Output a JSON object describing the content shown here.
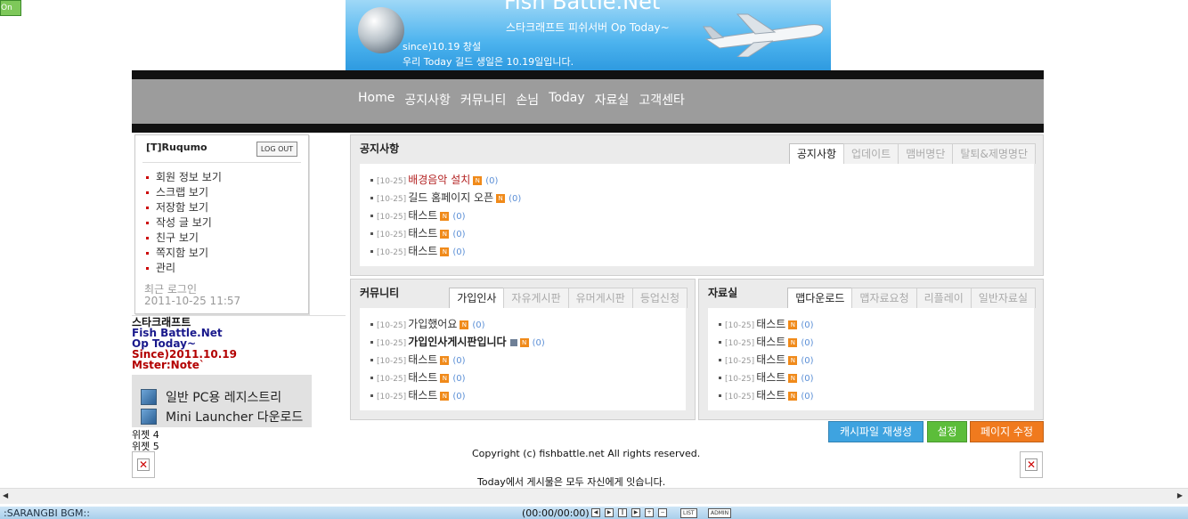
{
  "toggle": {
    "label": "On"
  },
  "banner": {
    "title": "Fish Battle.Net",
    "subtitle": "스타크래프트 피쉬서버 Op Today~",
    "line1": "since)10.19 창설",
    "line2": "우리 Today 길드 생일은 10.19일입니다."
  },
  "nav": {
    "items": [
      "Home",
      "공지사항",
      "커뮤니티",
      "손님",
      "Today",
      "자료실",
      "고객센타"
    ]
  },
  "login": {
    "user": "[T]Ruqumo",
    "logout": "LOG OUT",
    "menu": [
      "회원 정보 보기",
      "스크랩 보기",
      "저장함 보기",
      "작성 글 보기",
      "친구 보기",
      "쪽지함 보기",
      "관리"
    ],
    "last_login_label": "최근 로그인",
    "last_login_value": "2011-10-25 11:57"
  },
  "side": {
    "lines": [
      "스타크래프트",
      "Fish Battle.Net",
      "Op Today~",
      "Since)2011.10.19",
      "Mster:Note`"
    ],
    "pc_registry": "일반 PC용 레지스트리",
    "launcher": "Mini Launcher 다운로드",
    "widget4": "위젯 4",
    "widget5": "위젯 5"
  },
  "notice": {
    "title": "공지사항",
    "tabs": [
      "공지사항",
      "업데이트",
      "맴버명단",
      "탈퇴&제명명단"
    ],
    "items": [
      {
        "date": "[10-25]",
        "title": "배경음악 설치",
        "count": "(0)",
        "style": "red"
      },
      {
        "date": "[10-25]",
        "title": "길드 홈페이지 오픈",
        "count": "(0)",
        "style": ""
      },
      {
        "date": "[10-25]",
        "title": "태스트",
        "count": "(0)",
        "style": ""
      },
      {
        "date": "[10-25]",
        "title": "태스트",
        "count": "(0)",
        "style": ""
      },
      {
        "date": "[10-25]",
        "title": "태스트",
        "count": "(0)",
        "style": ""
      }
    ]
  },
  "community": {
    "title": "커뮤니티",
    "tabs": [
      "가입인사",
      "자유게시판",
      "유머게시판",
      "등업신청"
    ],
    "items": [
      {
        "date": "[10-25]",
        "title": "가입했어요",
        "count": "(0)",
        "style": ""
      },
      {
        "date": "[10-25]",
        "title": "가입인사게시판입니다",
        "count": "(0)",
        "style": "bold",
        "lock": true
      },
      {
        "date": "[10-25]",
        "title": "태스트",
        "count": "(0)",
        "style": ""
      },
      {
        "date": "[10-25]",
        "title": "태스트",
        "count": "(0)",
        "style": ""
      },
      {
        "date": "[10-25]",
        "title": "태스트",
        "count": "(0)",
        "style": ""
      }
    ]
  },
  "archive": {
    "title": "자료실",
    "tabs": [
      "맵다운로드",
      "맵자료요청",
      "리플레이",
      "일반자료실"
    ],
    "items": [
      {
        "date": "[10-25]",
        "title": "태스트",
        "count": "(0)",
        "style": ""
      },
      {
        "date": "[10-25]",
        "title": "태스트",
        "count": "(0)",
        "style": ""
      },
      {
        "date": "[10-25]",
        "title": "태스트",
        "count": "(0)",
        "style": ""
      },
      {
        "date": "[10-25]",
        "title": "태스트",
        "count": "(0)",
        "style": ""
      },
      {
        "date": "[10-25]",
        "title": "태스트",
        "count": "(0)",
        "style": ""
      }
    ]
  },
  "new_badge": "N",
  "buttons": {
    "cache": "캐시파일 재생성",
    "settings": "설정",
    "edit": "페이지 수정"
  },
  "colors": {
    "cache": "#3ea3e0",
    "settings": "#5cbd3a",
    "edit": "#f07a1e"
  },
  "footer": {
    "copyright": "Copyright (c) fishbattle.net All rights reserved.",
    "notice": "Today에서 게시물은 모두 자신에게 잇습니다."
  },
  "bgm": {
    "name": ":SARANGBI BGM::",
    "time": "(00:00/00:00)",
    "list": "LIST",
    "admin": "ADMIN"
  }
}
